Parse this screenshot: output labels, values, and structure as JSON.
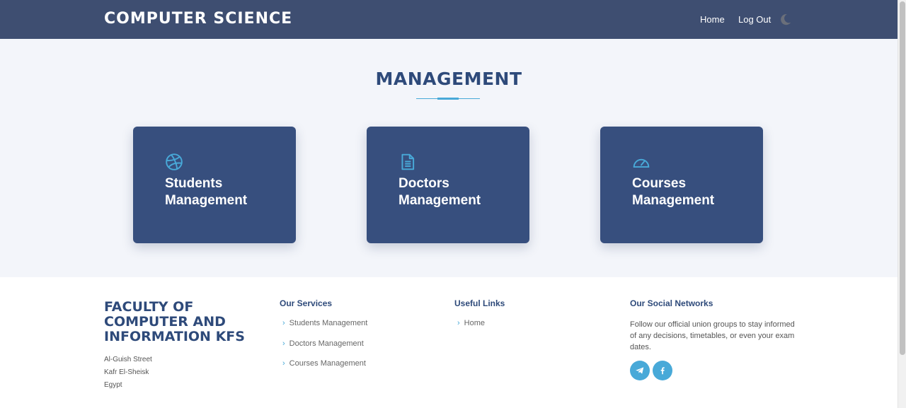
{
  "header": {
    "brand": "COMPUTER SCIENCE",
    "nav": [
      {
        "label": "Home"
      },
      {
        "label": "Log Out"
      }
    ],
    "theme_toggle_icon": "moon-icon"
  },
  "main": {
    "title": "MANAGEMENT",
    "cards": [
      {
        "icon": "dribbble-icon",
        "line1": "Students",
        "line2": "Management"
      },
      {
        "icon": "document-icon",
        "line1": "Doctors",
        "line2": "Management"
      },
      {
        "icon": "speedometer-icon",
        "line1": "Courses",
        "line2": "Management"
      }
    ]
  },
  "footer": {
    "faculty": "FACULTY OF COMPUTER AND INFORMATION KFS",
    "address": [
      "Al-Guish Street",
      "Kafr El-Sheisk",
      "Egypt"
    ],
    "services": {
      "heading": "Our Services",
      "links": [
        "Students Management",
        "Doctors Management",
        "Courses Management"
      ]
    },
    "useful": {
      "heading": "Useful Links",
      "links": [
        "Home"
      ]
    },
    "social": {
      "heading": "Our Social Networks",
      "text": "Follow our official union groups to stay informed of any decisions, timetables, or even your exam dates.",
      "icons": [
        "telegram-icon",
        "facebook-icon"
      ]
    }
  },
  "colors": {
    "header_bg": "#3e4e71",
    "card_bg": "#374f7e",
    "accent": "#48a9d8",
    "title": "#2e4a7a"
  }
}
